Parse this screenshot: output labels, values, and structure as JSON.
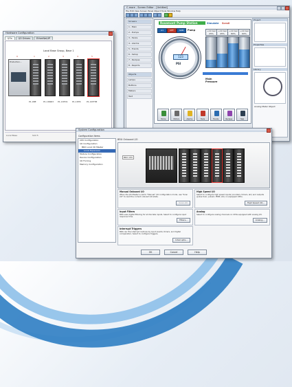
{
  "hardware_config": {
    "title": "Hardware Configuration",
    "tabs": [
      "I/Os",
      "I/O Drives",
      "EtherNet/IP"
    ],
    "base_label": "Local Base Group, Base 1",
    "slots": [
      "0",
      "1",
      "2",
      "3",
      "4",
      "5"
    ],
    "cpu_label": "Production...",
    "modules": [
      "P1-08E",
      "P1-16ND3",
      "P1-16TD1",
      "P1-16TR",
      "P1-04THM"
    ],
    "status": [
      "Local Base",
      "Slot 5"
    ]
  },
  "hmi_designer": {
    "title": "C-more - Screen Editor - [Untitled]",
    "menu": "File  Edit  View  Screen  Panel  Object  Tools  Window  Help",
    "left_panel": [
      "Screens",
      "1 - Main",
      "2 - Pumps",
      "3 - Tanks",
      "4 - Alarms",
      "5 - Trends",
      "6 - Setup",
      "7 - Recipes",
      "8 - Reports",
      "Objects",
      "Lamps",
      "Buttons",
      "Meters",
      "Text"
    ],
    "header": "Rosemont Pump Station",
    "labels": {
      "simulate": "Simulate",
      "scroll": "Scroll",
      "pump": "Pump"
    },
    "mode_buttons": {
      "a1": "A1",
      "off": "OFF",
      "arm": "ARM"
    },
    "gauge": {
      "reading": "123",
      "unit": "PSI",
      "needle_fraction": 0.62
    },
    "oil_tanks": [
      {
        "label": "+10 Gal\n25%",
        "level": 0.25
      },
      {
        "label": "+10 Gal\n45%",
        "level": 0.45
      },
      {
        "label": "+10 Gal\n80%",
        "level": 0.8
      },
      {
        "label": "+10 Gal\n60%",
        "level": 0.6
      }
    ],
    "motor_label": "Main\nPressure",
    "icon_bar": [
      {
        "name": "Home",
        "color": "#3a8f3a"
      },
      {
        "name": "Motors",
        "color": "#6b6b6b"
      },
      {
        "name": "Alarms",
        "color": "#e0b324"
      },
      {
        "name": "Tools",
        "color": "#c0392b"
      },
      {
        "name": "Trends",
        "color": "#2b6cb0"
      },
      {
        "name": "Recipes",
        "color": "#8e44ad"
      },
      {
        "name": "Help",
        "color": "#2c3e50"
      }
    ],
    "right_panel": {
      "heads": [
        "Project",
        "Properties",
        "Library"
      ],
      "footer": "Analog Meter Object"
    }
  },
  "system_config": {
    "title": "System Configuration",
    "tree_heading": "Configuration Items",
    "tree": [
      "CPU Configuration",
      "I/O Configuration",
      "BRX Local I/O Master",
      "Local Expansion",
      "Module Configuration",
      "Device Configuration",
      "I/O Forcing",
      "Memory Configuration"
    ],
    "selected_tree_index": 3,
    "panel_label": "BRX Onboard I/O",
    "preview_tag": "BRX CPU",
    "groups": [
      {
        "title": "Manual Onboard I/O",
        "desc": "When the I/O Master is set to \"Manual\" I/O configuration mode, use \"Scan I/O\" to read the current onboard I/O state.",
        "button": "Scan I/O",
        "disabled": true
      },
      {
        "title": "Input Filters",
        "desc": "BRX uses digital filtering for all discrete inputs. Select to configure input response time.",
        "button": "Filters...",
        "disabled": false
      },
      {
        "title": "Interrupt Triggers",
        "desc": "BRX can fire interrupt routines by input events, timers, and digital comparators. Select to configure triggers.",
        "button": "Interrupts...",
        "disabled": false
      },
      {
        "title": "High Speed I/O",
        "desc": "Select to configure high speed inputs (counters, timers, etc) and outputs (pulse train, pulsed, PWM, etc) on equipped CPUs.",
        "button": "High Speed I/O...",
        "disabled": false
      },
      {
        "title": "Analog",
        "desc": "Select to configure analog channels on CPUs equipped with analog I/O.",
        "button": "Analog...",
        "disabled": false
      }
    ],
    "footer_buttons": {
      "ok": "OK",
      "cancel": "Cancel",
      "help": "Help"
    }
  }
}
